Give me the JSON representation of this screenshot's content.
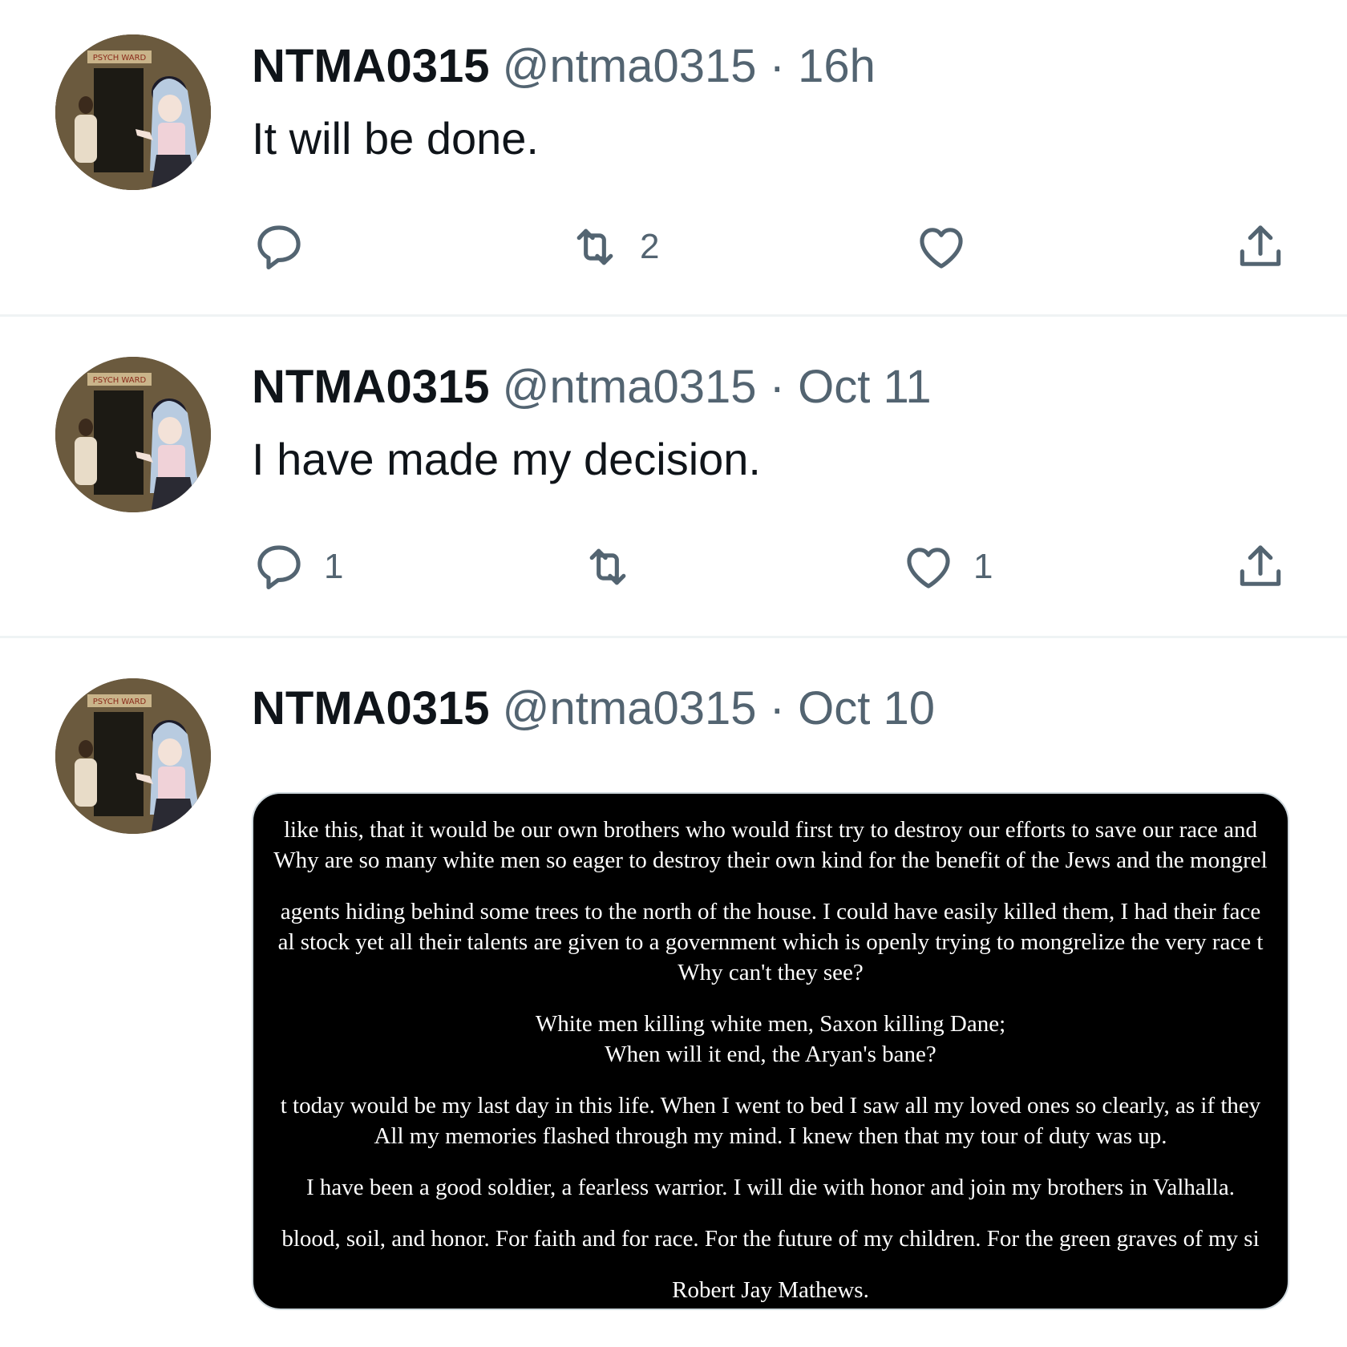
{
  "tweets": [
    {
      "name": "NTMA0315",
      "handle": "@ntma0315",
      "separator": "·",
      "time": "16h",
      "text": "It will be done.",
      "reply_count": "",
      "retweet_count": "2",
      "like_count": ""
    },
    {
      "name": "NTMA0315",
      "handle": "@ntma0315",
      "separator": "·",
      "time": "Oct 11",
      "text": "I have made my decision.",
      "reply_count": "1",
      "retweet_count": "",
      "like_count": "1"
    },
    {
      "name": "NTMA0315",
      "handle": "@ntma0315",
      "separator": "·",
      "time": "Oct 10",
      "text": ""
    }
  ],
  "avatar": {
    "sign_text": "PSYCH WARD"
  },
  "media": {
    "paragraphs": [
      [
        "like this, that it would be our own brothers who would first try to destroy our efforts to save our race and",
        "Why are so many white men so eager to destroy their own kind for the benefit of the Jews and the mongrel"
      ],
      [
        "agents hiding behind some trees to the north of the house. I could have easily killed them, I had their face",
        "al stock yet all their talents are given to a government which is openly trying to mongrelize the very race t",
        "Why can't they see?"
      ],
      [
        "White men killing white men, Saxon killing Dane;",
        "When will it end, the Aryan's bane?"
      ],
      [
        "t today would be my last day in this life. When I went to bed I saw all my loved ones so clearly, as if they",
        "All my memories flashed through my mind. I knew then that my tour of duty was up."
      ],
      [
        "I have been a good soldier, a fearless warrior. I will die with honor and join my brothers in Valhalla."
      ],
      [
        "blood, soil, and honor. For faith and for race. For the future of my children. For the green graves of my si"
      ],
      [
        "Robert Jay Mathews."
      ]
    ]
  },
  "icons": {
    "reply": "reply-icon",
    "retweet": "retweet-icon",
    "like": "like-icon",
    "share": "share-icon"
  },
  "colors": {
    "primary_text": "#0f1419",
    "secondary_text": "#536471",
    "divider": "#eff3f4"
  }
}
